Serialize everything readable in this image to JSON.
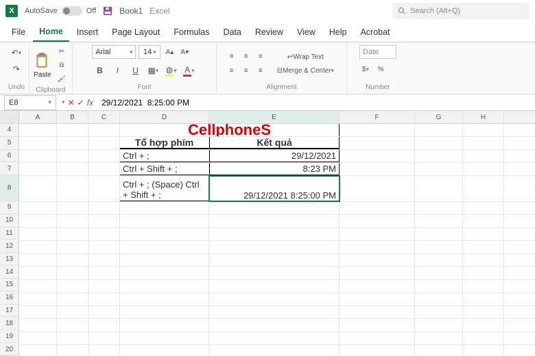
{
  "title": {
    "autosave_label": "AutoSave",
    "autosave_state": "Off",
    "doc_name": "Book1",
    "app_name": "Excel"
  },
  "search": {
    "placeholder": "Search (Alt+Q)"
  },
  "tabs": [
    "File",
    "Home",
    "Insert",
    "Page Layout",
    "Formulas",
    "Data",
    "Review",
    "View",
    "Help",
    "Acrobat"
  ],
  "active_tab": "Home",
  "ribbon": {
    "undo": "Undo",
    "clipboard": {
      "label": "Clipboard",
      "paste": "Paste"
    },
    "font": {
      "label": "Font",
      "name": "Arial",
      "size": "14",
      "b": "B",
      "i": "I",
      "u": "U"
    },
    "alignment": {
      "label": "Alignment",
      "wrap": "Wrap Text",
      "merge": "Merge & Center"
    },
    "number": {
      "label": "Number",
      "format": "Date",
      "currency": "$"
    }
  },
  "formula": {
    "namebox": "E8",
    "content": "29/12/2021  8:25:00 PM"
  },
  "columns": [
    "A",
    "B",
    "C",
    "D",
    "E",
    "F",
    "G",
    "H"
  ],
  "row_numbers": [
    4,
    5,
    6,
    7,
    8,
    9,
    10,
    11,
    12,
    13,
    14,
    15,
    16,
    17,
    18,
    19,
    20
  ],
  "sheet": {
    "title": "CellphoneS",
    "headers": {
      "combo": "Tổ hợp phím",
      "result": "Kết quả"
    },
    "rows": [
      {
        "combo": "Ctrl + ;",
        "result": "29/12/2021"
      },
      {
        "combo": "Ctrl + Shift + ;",
        "result": "8:23 PM"
      },
      {
        "combo": "Ctrl + ; (Space) Ctrl + Shift + ;",
        "result": "29/12/2021  8:25:00 PM"
      }
    ]
  }
}
